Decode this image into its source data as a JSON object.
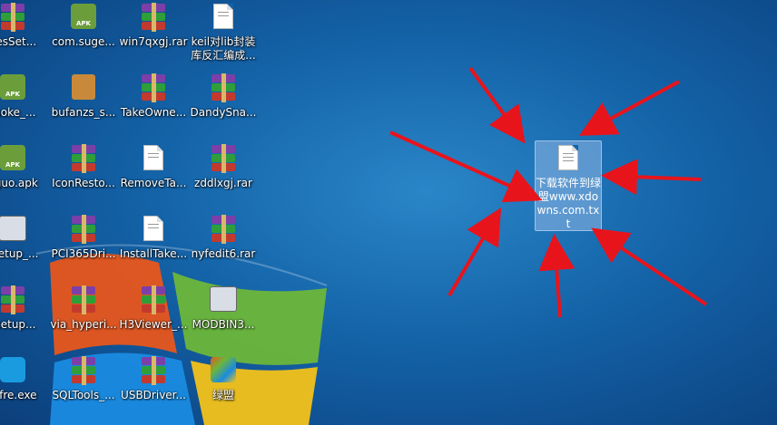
{
  "desktop": {
    "icons": [
      {
        "label": "nesSet...",
        "type": "rar"
      },
      {
        "label": "com.suge...",
        "type": "apk"
      },
      {
        "label": "win7qxgj.rar",
        "type": "rar"
      },
      {
        "label": "keil对lib封装库反汇编成...",
        "type": "doc"
      },
      {
        "label": "raoke_...",
        "type": "apk"
      },
      {
        "label": "bufanzs_s...",
        "type": "box"
      },
      {
        "label": "TakeOwne...",
        "type": "rar"
      },
      {
        "label": "DandySna...",
        "type": "rar"
      },
      {
        "label": "nguo.apk",
        "type": "apk"
      },
      {
        "label": "IconResto...",
        "type": "rar"
      },
      {
        "label": "RemoveTa...",
        "type": "doc"
      },
      {
        "label": "zddlxgj.rar",
        "type": "rar"
      },
      {
        "label": "_setup_...",
        "type": "app"
      },
      {
        "label": "PCI365Dri...",
        "type": "rar"
      },
      {
        "label": "InstallTake...",
        "type": "doc"
      },
      {
        "label": "nyfedit6.rar",
        "type": "rar"
      },
      {
        "label": "_setup...",
        "type": "rar"
      },
      {
        "label": "via_hyperi...",
        "type": "rar"
      },
      {
        "label": "H3Viewer_...",
        "type": "rar"
      },
      {
        "label": "MODBIN3...",
        "type": "app"
      },
      {
        "label": "uffre.exe",
        "type": "wifi"
      },
      {
        "label": "SQLTools_...",
        "type": "rar"
      },
      {
        "label": "USBDriver...",
        "type": "rar"
      },
      {
        "label": "绿盟",
        "type": "shortcut"
      }
    ],
    "selected_icon": {
      "label": "下载软件到绿盟www.xdowns.com.txt",
      "type": "txt"
    }
  },
  "colors": {
    "arrow": "#e8141c",
    "selection": "#aac8f0"
  }
}
